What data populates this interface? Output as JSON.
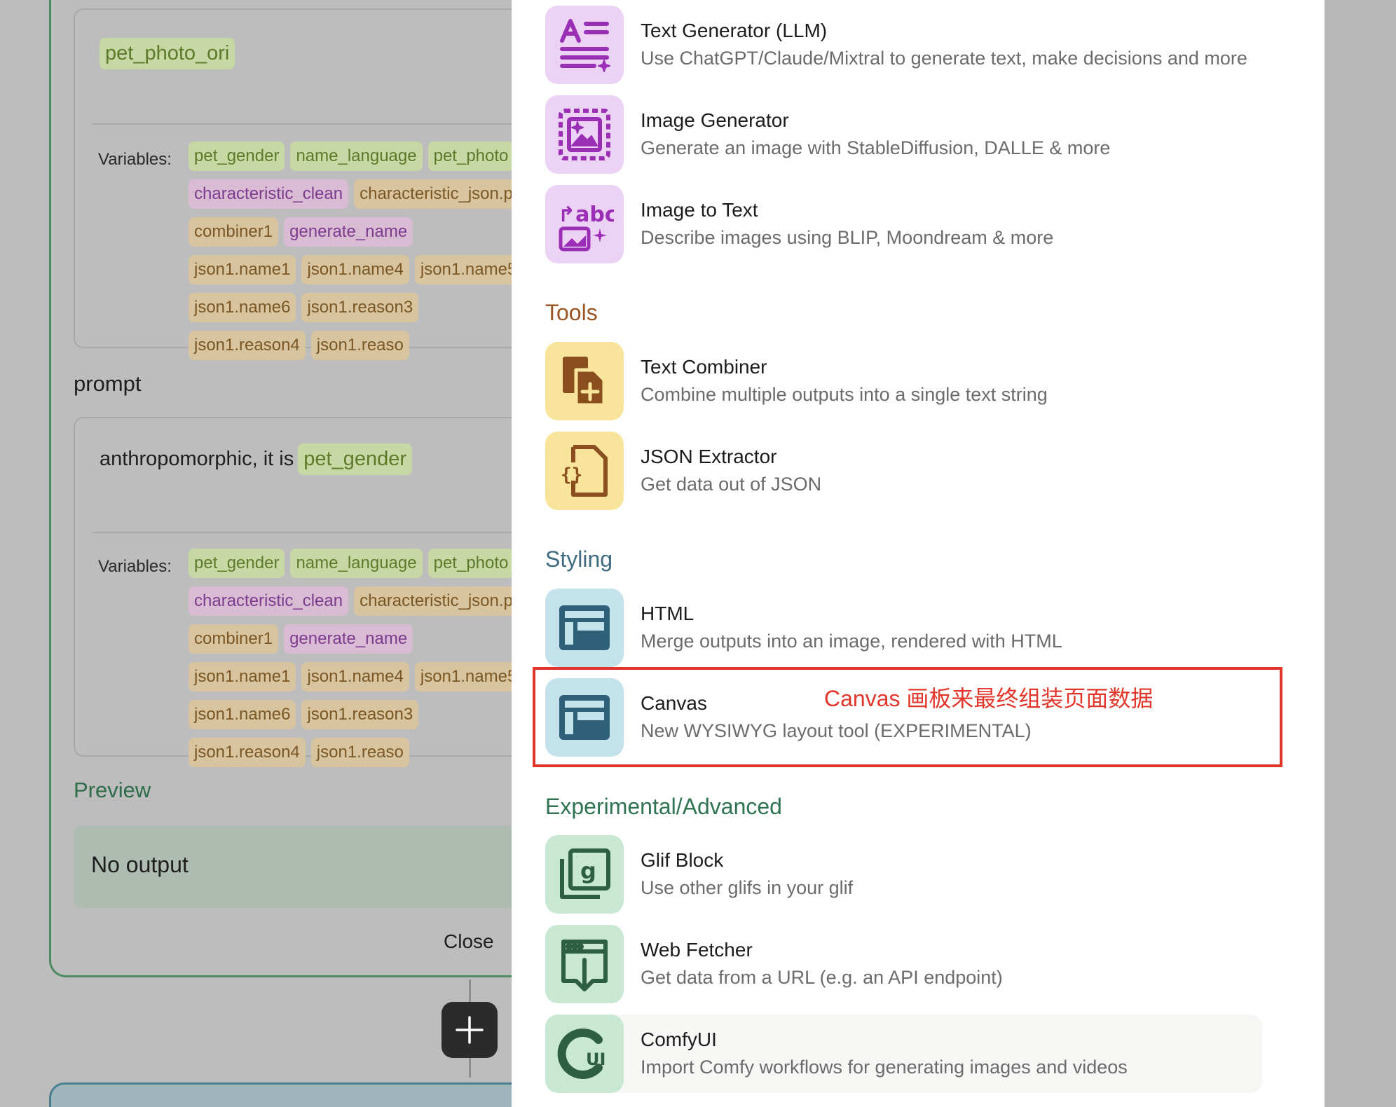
{
  "workflow": {
    "block1": {
      "value_chip": "pet_photo_ori",
      "variables_label": "Variables:",
      "variables": [
        {
          "name": "pet_gender",
          "tone": "green"
        },
        {
          "name": "name_language",
          "tone": "green"
        },
        {
          "name": "pet_photo",
          "tone": "green"
        },
        {
          "name": "characteristic_clean",
          "tone": "purple"
        },
        {
          "name": "characteristic_json.p",
          "tone": "tan"
        },
        {
          "name": "combiner1",
          "tone": "tan"
        },
        {
          "name": "generate_name",
          "tone": "purple"
        },
        {
          "name": "json1.name1",
          "tone": "tan"
        },
        {
          "name": "json1.name4",
          "tone": "tan"
        },
        {
          "name": "json1.name5",
          "tone": "tan"
        },
        {
          "name": "json1.name6",
          "tone": "tan"
        },
        {
          "name": "json1.reason3",
          "tone": "tan"
        },
        {
          "name": "json1.reason4",
          "tone": "tan"
        },
        {
          "name": "json1.reaso",
          "tone": "tan"
        }
      ]
    },
    "prompt_label": "prompt",
    "block2": {
      "text": "anthropomorphic, it is",
      "value_chip": "pet_gender",
      "variables_label": "Variables:",
      "variables": [
        {
          "name": "pet_gender",
          "tone": "green"
        },
        {
          "name": "name_language",
          "tone": "green"
        },
        {
          "name": "pet_photo",
          "tone": "green"
        },
        {
          "name": "characteristic_clean",
          "tone": "purple"
        },
        {
          "name": "characteristic_json.p",
          "tone": "tan"
        },
        {
          "name": "combiner1",
          "tone": "tan"
        },
        {
          "name": "generate_name",
          "tone": "purple"
        },
        {
          "name": "json1.name1",
          "tone": "tan"
        },
        {
          "name": "json1.name4",
          "tone": "tan"
        },
        {
          "name": "json1.name5",
          "tone": "tan"
        },
        {
          "name": "json1.name6",
          "tone": "tan"
        },
        {
          "name": "json1.reason3",
          "tone": "tan"
        },
        {
          "name": "json1.reason4",
          "tone": "tan"
        },
        {
          "name": "json1.reaso",
          "tone": "tan"
        }
      ]
    },
    "preview_label": "Preview",
    "preview_output": "No output",
    "close_label": "Close"
  },
  "menu": {
    "items": [
      {
        "title": "Text Generator (LLM)",
        "desc": "Use ChatGPT/Claude/Mixtral to generate text, make decisions and more",
        "icon": "text-generator-icon"
      },
      {
        "title": "Image Generator",
        "desc": "Generate an image with StableDiffusion, DALLE & more",
        "icon": "image-generator-icon"
      },
      {
        "title": "Image to Text",
        "desc": "Describe images using BLIP, Moondream & more",
        "icon": "image-to-text-icon"
      },
      {
        "title": "Text Combiner",
        "desc": "Combine multiple outputs into a single text string",
        "icon": "text-combiner-icon"
      },
      {
        "title": "JSON Extractor",
        "desc": "Get data out of JSON",
        "icon": "json-extractor-icon"
      },
      {
        "title": "HTML",
        "desc": "Merge outputs into an image, rendered with HTML",
        "icon": "layout-icon"
      },
      {
        "title": "Canvas",
        "desc": "New WYSIWYG layout tool (EXPERIMENTAL)",
        "icon": "layout-icon"
      },
      {
        "title": "Glif Block",
        "desc": "Use other glifs in your glif",
        "icon": "glif-block-icon"
      },
      {
        "title": "Web Fetcher",
        "desc": "Get data from a URL (e.g. an API endpoint)",
        "icon": "web-fetcher-icon"
      },
      {
        "title": "ComfyUI",
        "desc": "Import Comfy workflows for generating images and videos",
        "icon": "comfyui-icon"
      }
    ],
    "categories": {
      "tools": "Tools",
      "styling": "Styling",
      "experimental": "Experimental/Advanced"
    }
  },
  "annotation": "Canvas 画板来最终组装页面数据",
  "colors": {
    "purple_tile": "#ecd2f4",
    "purple_icon": "#9a2fb5",
    "yellow_tile": "#f8e49a",
    "brown_icon": "#8b4f1f",
    "blue_tile": "#c4e2ec",
    "blue_icon": "#305f78",
    "green_tile": "#c8e8d3",
    "green_icon": "#2e5e44",
    "tools_title": "#9a5522",
    "styling_title": "#3f6b80",
    "experimental_title": "#2f7350",
    "highlight": "#e2362b"
  }
}
